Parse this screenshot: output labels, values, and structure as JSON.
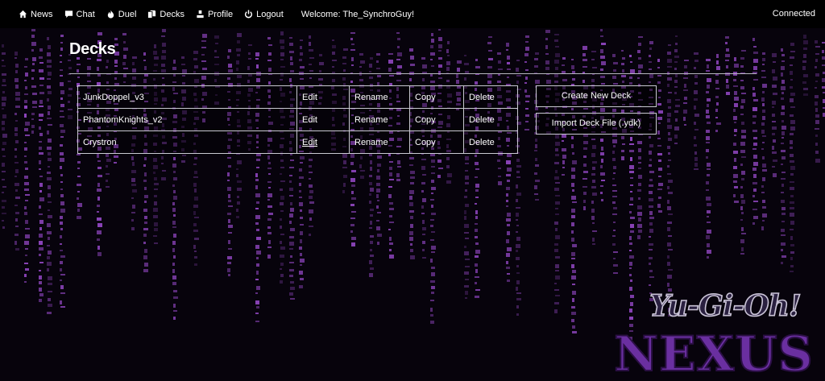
{
  "nav": {
    "items": [
      {
        "label": "News",
        "icon": "home-icon"
      },
      {
        "label": "Chat",
        "icon": "chat-bubble-icon"
      },
      {
        "label": "Duel",
        "icon": "fire-icon"
      },
      {
        "label": "Decks",
        "icon": "documents-icon"
      },
      {
        "label": "Profile",
        "icon": "user-icon"
      },
      {
        "label": "Logout",
        "icon": "power-icon"
      }
    ],
    "welcome": "Welcome: The_SynchroGuy!",
    "status": "Connected"
  },
  "page": {
    "title": "Decks"
  },
  "decks": [
    {
      "name": "JunkDoppel_v3",
      "edit": "Edit",
      "rename": "Rename",
      "copy": "Copy",
      "delete": "Delete"
    },
    {
      "name": "PhantomKnights_v2",
      "edit": "Edit",
      "rename": "Rename",
      "copy": "Copy",
      "delete": "Delete"
    },
    {
      "name": "Crystron",
      "edit": "Edit",
      "rename": "Rename",
      "copy": "Copy",
      "delete": "Delete"
    }
  ],
  "actions": {
    "create_label": "Create New Deck",
    "import_label": "Import Deck File (.ydk)"
  },
  "logo": {
    "line1": "Yu-Gi-Oh!",
    "line2": "NEXUS"
  },
  "colors": {
    "background": "#07030c",
    "rain": "#a24fd8",
    "navbar": "#000000",
    "text": "#ffffff",
    "logo_purple": "#6a2fa0"
  }
}
